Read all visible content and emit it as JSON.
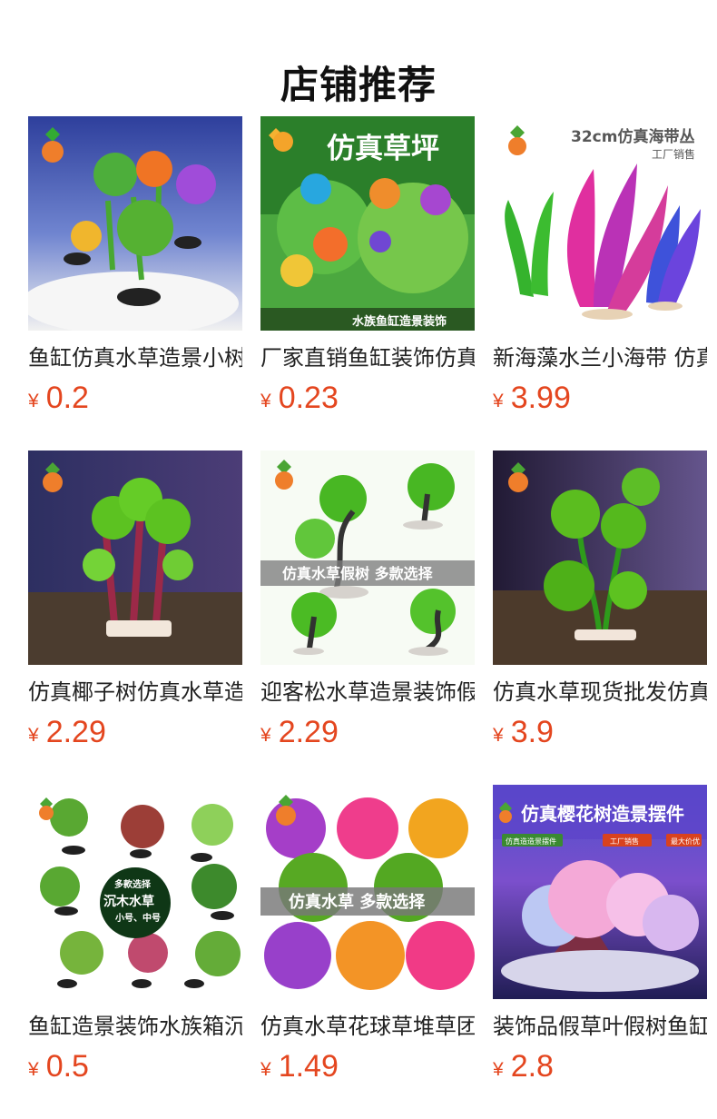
{
  "shop": {
    "section_title": "店铺推荐"
  },
  "products": [
    {
      "name": "鱼缸仿真水草造景小树装饰",
      "currency": "¥",
      "price": "0.2",
      "image_text": [],
      "colors": {
        "bg": "#4b67b8",
        "accent": "#ef7e2b"
      }
    },
    {
      "name": "厂家直销鱼缸装饰仿真水草",
      "currency": "¥",
      "price": "0.23",
      "image_text": [
        "仿真草坪",
        "水族鱼缸造景装饰"
      ],
      "colors": {
        "bg": "#3f9a39",
        "accent": "#e55a6c"
      }
    },
    {
      "name": "新海藻水兰小海带 仿真水草",
      "currency": "¥",
      "price": "3.99",
      "image_text": [
        "32cm仿真海带丛",
        "工厂销售"
      ],
      "colors": {
        "bg": "#ffffff",
        "accent": "#c62f9e"
      }
    },
    {
      "name": "仿真椰子树仿真水草造景",
      "currency": "¥",
      "price": "2.29",
      "image_text": [],
      "colors": {
        "bg": "#463a64",
        "accent": "#64b81f"
      }
    },
    {
      "name": "迎客松水草造景装饰假树",
      "currency": "¥",
      "price": "2.29",
      "image_text": [
        "仿真水草假树 多款选择"
      ],
      "colors": {
        "bg": "#f2f8ed",
        "accent": "#4fbe28"
      }
    },
    {
      "name": "仿真水草现货批发仿真植物",
      "currency": "¥",
      "price": "3.9",
      "image_text": [],
      "colors": {
        "bg": "#3b3158",
        "accent": "#56b91b"
      }
    },
    {
      "name": "鱼缸造景装饰水族箱沉木水草",
      "currency": "¥",
      "price": "0.5",
      "image_text": [
        "多款选择",
        "沉木水草",
        "小号、中号"
      ],
      "colors": {
        "bg": "#ffffff",
        "accent": "#61a82f"
      }
    },
    {
      "name": "仿真水草花球草堆草团",
      "currency": "¥",
      "price": "1.49",
      "image_text": [
        "仿真水草 多款选择"
      ],
      "colors": {
        "bg": "#ffffff",
        "accent": "#ef3d8c"
      }
    },
    {
      "name": "装饰品假草叶假树鱼缸造景",
      "currency": "¥",
      "price": "2.8",
      "image_text": [
        "仿真樱花树造景摆件",
        "仿真造造景摆件",
        "工厂销售",
        "最大价优"
      ],
      "colors": {
        "bg": "#5f4ecc",
        "accent": "#f0a4d1"
      }
    }
  ]
}
